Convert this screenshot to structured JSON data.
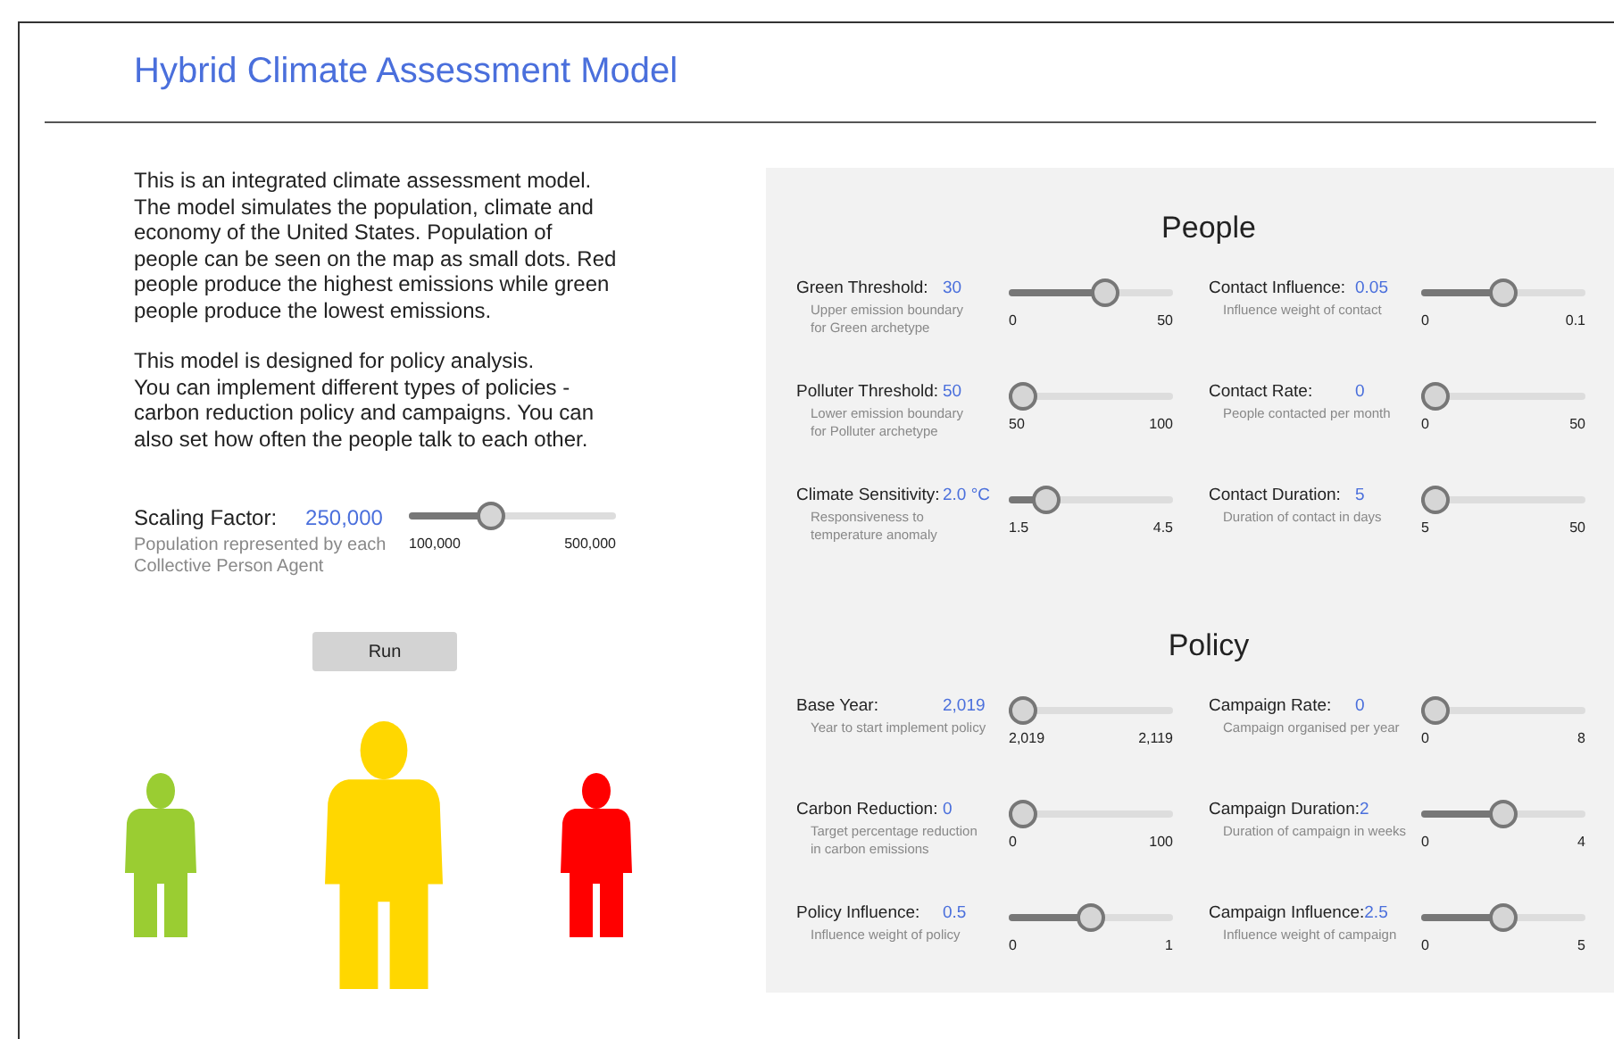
{
  "title": "Hybrid Climate Assessment Model",
  "intro": [
    [
      "This is an integrated climate assessment model. The model simulates the population, climate and economy of the United States. Population of people can be seen on the map as small dots. Red people produce the highest emissions while green people produce the lowest emissions."
    ],
    [
      "This model is designed for policy analysis.",
      "You can implement different types of policies - carbon reduction policy and campaigns. You can also set how often the people talk to each other."
    ]
  ],
  "scaling": {
    "label": "Scaling Factor:",
    "value": "250,000",
    "description": [
      "Population represented by each",
      "Collective Person Agent"
    ],
    "level": 0.375,
    "min": "100,000",
    "max": "500,000"
  },
  "run_button": "Run",
  "figures": [
    {
      "kind": "small",
      "color": "#9acd32"
    },
    {
      "kind": "large",
      "color": "#ffd700"
    },
    {
      "kind": "small",
      "color": "#ff0000"
    }
  ],
  "sections": [
    {
      "title": "People",
      "params": [
        {
          "label": "Green Threshold:",
          "value": "30",
          "description": [
            "Upper emission boundary",
            "for Green archetype"
          ],
          "level": 0.6,
          "min": "0",
          "max": "50"
        },
        {
          "label": "Contact Influence:",
          "value": "0.05",
          "description": [
            "Influence weight of contact"
          ],
          "level": 0.5,
          "min": "0",
          "max": "0.1"
        },
        {
          "label": "Polluter Threshold:",
          "value": "50",
          "description": [
            "Lower emission boundary",
            "for Polluter archetype"
          ],
          "level": 0,
          "min": "50",
          "max": "100"
        },
        {
          "label": "Contact Rate:",
          "value": "0",
          "description": [
            "People contacted per month"
          ],
          "level": 0,
          "min": "0",
          "max": "50"
        },
        {
          "label": "Climate Sensitivity:",
          "value": "2.0 °C",
          "description": [
            "Responsiveness to",
            "temperature anomaly"
          ],
          "level": 0.167,
          "min": "1.5",
          "max": "4.5"
        },
        {
          "label": "Contact Duration:",
          "value": "5",
          "description": [
            "Duration of contact in days"
          ],
          "level": 0,
          "min": "5",
          "max": "50"
        }
      ]
    },
    {
      "title": "Policy",
      "params": [
        {
          "label": "Base Year:",
          "value": "2,019",
          "description": [
            "Year to start implement policy"
          ],
          "level": 0,
          "min": "2,019",
          "max": "2,119"
        },
        {
          "label": "Campaign Rate:",
          "value": "0",
          "description": [
            "Campaign organised per year"
          ],
          "level": 0,
          "min": "0",
          "max": "8"
        },
        {
          "label": "Carbon Reduction:",
          "value": "0",
          "description": [
            "Target percentage reduction",
            "in carbon emissions"
          ],
          "level": 0,
          "min": "0",
          "max": "100"
        },
        {
          "label": "Campaign Duration:",
          "value": "2",
          "description": [
            "Duration of campaign in weeks"
          ],
          "level": 0.5,
          "min": "0",
          "max": "4"
        },
        {
          "label": "Policy Influence:",
          "value": "0.5",
          "description": [
            "Influence weight of policy"
          ],
          "level": 0.5,
          "min": "0",
          "max": "1"
        },
        {
          "label": "Campaign Influence:",
          "value": "2.5",
          "description": [
            "Influence weight of campaign"
          ],
          "level": 0.5,
          "min": "0",
          "max": "5"
        }
      ]
    }
  ]
}
